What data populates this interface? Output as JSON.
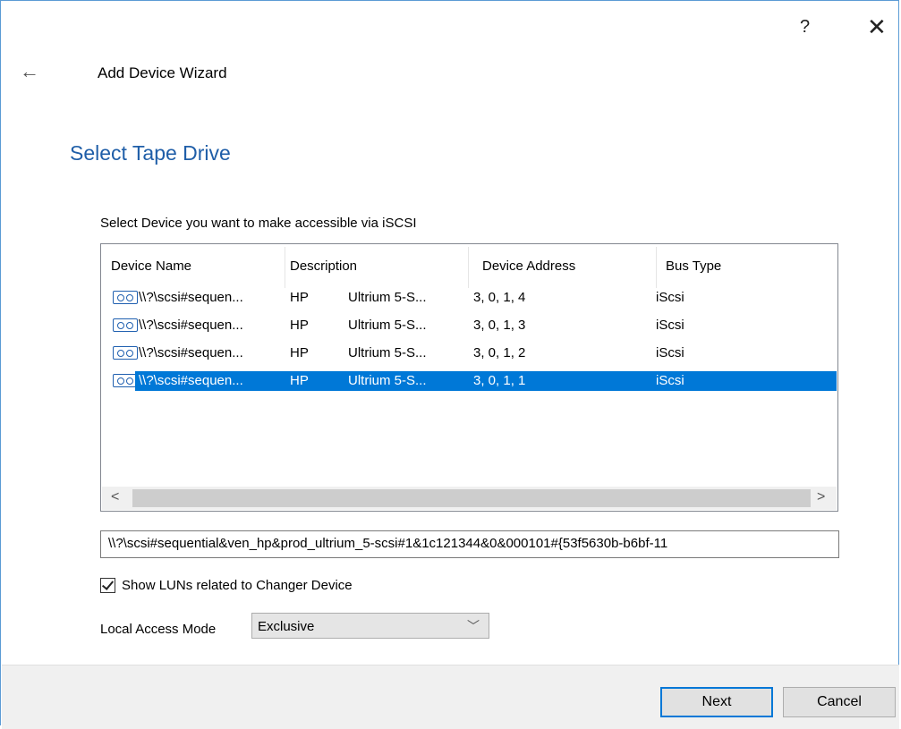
{
  "titlebar": {
    "help_label": "?",
    "close_label": "✕"
  },
  "nav": {
    "back_label": "←",
    "wizard_title": "Add Device Wizard"
  },
  "page": {
    "heading": "Select Tape Drive",
    "instruction": "Select Device you want to make accessible via iSCSI"
  },
  "device_list": {
    "columns": [
      "Device Name",
      "Description",
      "Device Address",
      "Bus Type"
    ],
    "rows": [
      {
        "name": "\\\\?\\scsi#sequen...",
        "vendor": "HP",
        "model": "Ultrium 5-S...",
        "address": "3, 0, 1, 4",
        "bus": "iScsi",
        "selected": false
      },
      {
        "name": "\\\\?\\scsi#sequen...",
        "vendor": "HP",
        "model": "Ultrium 5-S...",
        "address": "3, 0, 1, 3",
        "bus": "iScsi",
        "selected": false
      },
      {
        "name": "\\\\?\\scsi#sequen...",
        "vendor": "HP",
        "model": "Ultrium 5-S...",
        "address": "3, 0, 1, 2",
        "bus": "iScsi",
        "selected": false
      },
      {
        "name": "\\\\?\\scsi#sequen...",
        "vendor": "HP",
        "model": "Ultrium 5-S...",
        "address": "3, 0, 1, 1",
        "bus": "iScsi",
        "selected": true
      }
    ],
    "row_icon": "tape-drive-icon",
    "scroll_left": "<",
    "scroll_right": ">"
  },
  "device_path": "\\\\?\\scsi#sequential&ven_hp&prod_ultrium_5-scsi#1&1c121344&0&000101#{53f5630b-b6bf-11",
  "show_luns": {
    "label": "Show LUNs related to Changer Device",
    "checked": true
  },
  "access_mode": {
    "label": "Local Access Mode",
    "value": "Exclusive",
    "chevron": "﹀"
  },
  "buttons": {
    "next": "Next",
    "cancel": "Cancel"
  },
  "colors": {
    "accent": "#0078d7",
    "heading": "#1f5ea8",
    "footer_bg": "#f0f0f0"
  }
}
